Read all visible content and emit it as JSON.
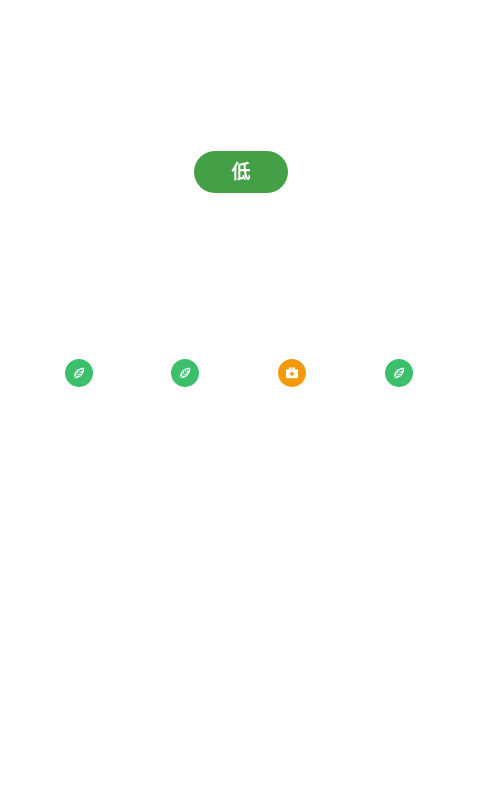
{
  "level_badge": {
    "label": "低",
    "color": "#43a047"
  },
  "indicators": [
    {
      "icon": "leaf-icon",
      "color": "#3cbf6a"
    },
    {
      "icon": "leaf-icon",
      "color": "#3cbf6a"
    },
    {
      "icon": "medical-kit-icon",
      "color": "#f39a0b"
    },
    {
      "icon": "leaf-icon",
      "color": "#3cbf6a"
    }
  ]
}
